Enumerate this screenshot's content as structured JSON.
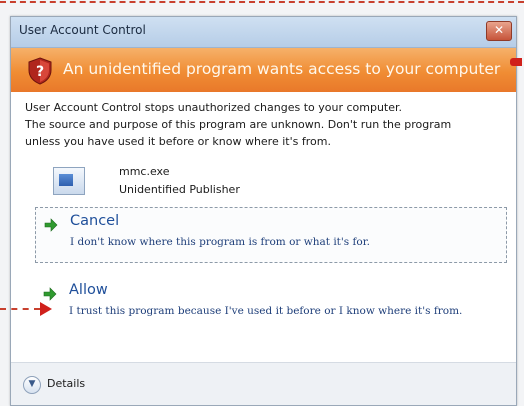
{
  "window": {
    "title": "User Account Control",
    "close_label": "✕"
  },
  "banner": {
    "text": "An unidentified program wants access to your computer"
  },
  "message": {
    "line1": "User Account Control stops unauthorized changes to your computer.",
    "line2": "The source and purpose of this program are unknown.  Don't run the program",
    "line3": "unless you have used it before or know where it's from."
  },
  "program": {
    "name": "mmc.exe",
    "publisher": "Unidentified Publisher"
  },
  "options": {
    "cancel": {
      "label": "Cancel",
      "description": "I don't know where this program is from or what it's for."
    },
    "allow": {
      "label": "Allow",
      "description": "I trust this program because I've used it before or I know where it's from."
    }
  },
  "footer": {
    "details_label": "Details"
  },
  "colors": {
    "banner": "#f08d34",
    "accent_link": "#1f4f9a",
    "callout": "#d0211c"
  }
}
